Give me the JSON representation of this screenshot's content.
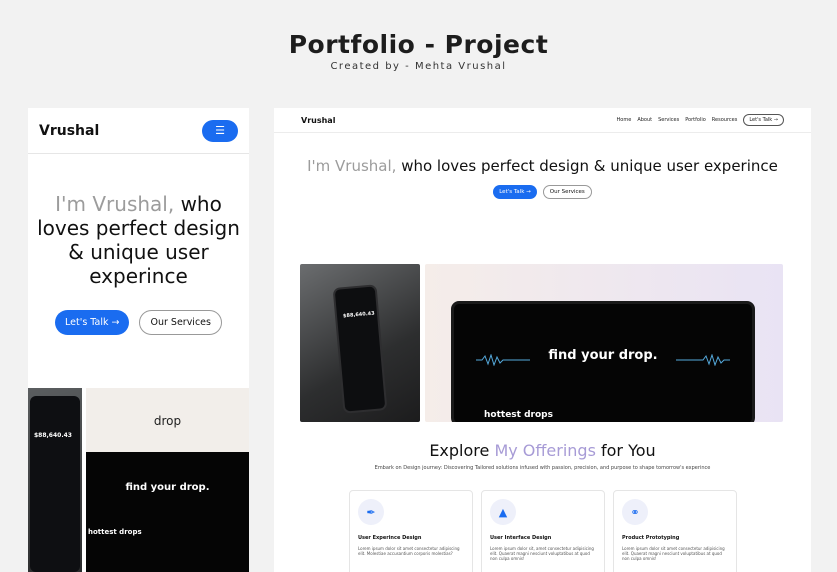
{
  "header": {
    "title": "Portfolio - Project",
    "subtitle": "Created by - Mehta Vrushal"
  },
  "mobile": {
    "logo": "Vrushal",
    "menu_icon": "☰",
    "hero_grey": "I'm Vrushal,",
    "hero_rest": " who loves perfect design & unique user experince",
    "cta_primary": "Let's Talk →",
    "cta_secondary": "Our Services",
    "phone_balance": "$88,640.43",
    "drop_logo": "drop",
    "drop_headline": "find your drop.",
    "hottest": "hottest drops"
  },
  "desktop": {
    "logo": "Vrushal",
    "nav": [
      "Home",
      "About",
      "Services",
      "Portfolio",
      "Resources"
    ],
    "nav_cta": "Let's Talk →",
    "hero_grey": "I'm Vrushal,",
    "hero_rest": " who loves perfect design & unique user experince",
    "cta_primary": "Let's Talk →",
    "cta_secondary": "Our Services",
    "phone_balance": "$88,640.43",
    "laptop_headline": "find your drop.",
    "hottest": "hottest drops",
    "offer_a": "Explore ",
    "offer_hl": "My Offerings",
    "offer_b": " for You",
    "offer_sub": "Embark on Design journey: Discovering Tailored solutions infused with passion, precision, and purpose to shape tomorrow's experince",
    "cards": [
      {
        "icon": "feather-icon",
        "glyph": "✒",
        "title": "User Experince Design",
        "desc": "Lorem ipsum dolor sit amet consectetur adipiscing elit. Molestiae accusantium corporis molestias?"
      },
      {
        "icon": "shapes-icon",
        "glyph": "▲",
        "title": "User Interface Design",
        "desc": "Lorem ipsum dolor sit, amet consectetur adipisicing elit. Quaerat magni nesciunt voluptatibus at quod non culpa omnis!"
      },
      {
        "icon": "link-icon",
        "glyph": "⚭",
        "title": "Product Prototyping",
        "desc": "Lorem ipsum dolor sit amet consectetur adipisicing elit. Quaerat magni nesciunt voluptatibus at quod non culpa omnis!"
      }
    ]
  },
  "colors": {
    "accent": "#1a6cf0",
    "highlight": "#a79bd6"
  }
}
